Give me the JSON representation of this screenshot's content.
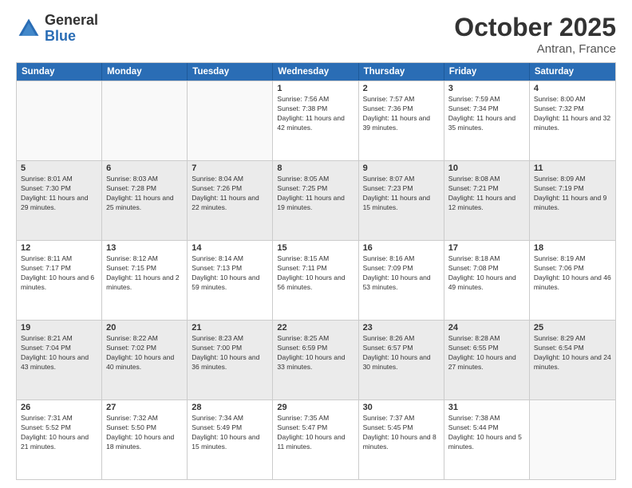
{
  "header": {
    "logo_general": "General",
    "logo_blue": "Blue",
    "month_title": "October 2025",
    "location": "Antran, France"
  },
  "weekdays": [
    "Sunday",
    "Monday",
    "Tuesday",
    "Wednesday",
    "Thursday",
    "Friday",
    "Saturday"
  ],
  "weeks": [
    [
      {
        "day": "",
        "empty": true
      },
      {
        "day": "",
        "empty": true
      },
      {
        "day": "",
        "empty": true
      },
      {
        "day": "1",
        "sunrise": "7:56 AM",
        "sunset": "7:38 PM",
        "daylight": "11 hours and 42 minutes."
      },
      {
        "day": "2",
        "sunrise": "7:57 AM",
        "sunset": "7:36 PM",
        "daylight": "11 hours and 39 minutes."
      },
      {
        "day": "3",
        "sunrise": "7:59 AM",
        "sunset": "7:34 PM",
        "daylight": "11 hours and 35 minutes."
      },
      {
        "day": "4",
        "sunrise": "8:00 AM",
        "sunset": "7:32 PM",
        "daylight": "11 hours and 32 minutes."
      }
    ],
    [
      {
        "day": "5",
        "sunrise": "8:01 AM",
        "sunset": "7:30 PM",
        "daylight": "11 hours and 29 minutes."
      },
      {
        "day": "6",
        "sunrise": "8:03 AM",
        "sunset": "7:28 PM",
        "daylight": "11 hours and 25 minutes."
      },
      {
        "day": "7",
        "sunrise": "8:04 AM",
        "sunset": "7:26 PM",
        "daylight": "11 hours and 22 minutes."
      },
      {
        "day": "8",
        "sunrise": "8:05 AM",
        "sunset": "7:25 PM",
        "daylight": "11 hours and 19 minutes."
      },
      {
        "day": "9",
        "sunrise": "8:07 AM",
        "sunset": "7:23 PM",
        "daylight": "11 hours and 15 minutes."
      },
      {
        "day": "10",
        "sunrise": "8:08 AM",
        "sunset": "7:21 PM",
        "daylight": "11 hours and 12 minutes."
      },
      {
        "day": "11",
        "sunrise": "8:09 AM",
        "sunset": "7:19 PM",
        "daylight": "11 hours and 9 minutes."
      }
    ],
    [
      {
        "day": "12",
        "sunrise": "8:11 AM",
        "sunset": "7:17 PM",
        "daylight": "10 hours and 6 minutes."
      },
      {
        "day": "13",
        "sunrise": "8:12 AM",
        "sunset": "7:15 PM",
        "daylight": "11 hours and 2 minutes."
      },
      {
        "day": "14",
        "sunrise": "8:14 AM",
        "sunset": "7:13 PM",
        "daylight": "10 hours and 59 minutes."
      },
      {
        "day": "15",
        "sunrise": "8:15 AM",
        "sunset": "7:11 PM",
        "daylight": "10 hours and 56 minutes."
      },
      {
        "day": "16",
        "sunrise": "8:16 AM",
        "sunset": "7:09 PM",
        "daylight": "10 hours and 53 minutes."
      },
      {
        "day": "17",
        "sunrise": "8:18 AM",
        "sunset": "7:08 PM",
        "daylight": "10 hours and 49 minutes."
      },
      {
        "day": "18",
        "sunrise": "8:19 AM",
        "sunset": "7:06 PM",
        "daylight": "10 hours and 46 minutes."
      }
    ],
    [
      {
        "day": "19",
        "sunrise": "8:21 AM",
        "sunset": "7:04 PM",
        "daylight": "10 hours and 43 minutes."
      },
      {
        "day": "20",
        "sunrise": "8:22 AM",
        "sunset": "7:02 PM",
        "daylight": "10 hours and 40 minutes."
      },
      {
        "day": "21",
        "sunrise": "8:23 AM",
        "sunset": "7:00 PM",
        "daylight": "10 hours and 36 minutes."
      },
      {
        "day": "22",
        "sunrise": "8:25 AM",
        "sunset": "6:59 PM",
        "daylight": "10 hours and 33 minutes."
      },
      {
        "day": "23",
        "sunrise": "8:26 AM",
        "sunset": "6:57 PM",
        "daylight": "10 hours and 30 minutes."
      },
      {
        "day": "24",
        "sunrise": "8:28 AM",
        "sunset": "6:55 PM",
        "daylight": "10 hours and 27 minutes."
      },
      {
        "day": "25",
        "sunrise": "8:29 AM",
        "sunset": "6:54 PM",
        "daylight": "10 hours and 24 minutes."
      }
    ],
    [
      {
        "day": "26",
        "sunrise": "7:31 AM",
        "sunset": "5:52 PM",
        "daylight": "10 hours and 21 minutes."
      },
      {
        "day": "27",
        "sunrise": "7:32 AM",
        "sunset": "5:50 PM",
        "daylight": "10 hours and 18 minutes."
      },
      {
        "day": "28",
        "sunrise": "7:34 AM",
        "sunset": "5:49 PM",
        "daylight": "10 hours and 15 minutes."
      },
      {
        "day": "29",
        "sunrise": "7:35 AM",
        "sunset": "5:47 PM",
        "daylight": "10 hours and 11 minutes."
      },
      {
        "day": "30",
        "sunrise": "7:37 AM",
        "sunset": "5:45 PM",
        "daylight": "10 hours and 8 minutes."
      },
      {
        "day": "31",
        "sunrise": "7:38 AM",
        "sunset": "5:44 PM",
        "daylight": "10 hours and 5 minutes."
      },
      {
        "day": "",
        "empty": true
      }
    ]
  ]
}
